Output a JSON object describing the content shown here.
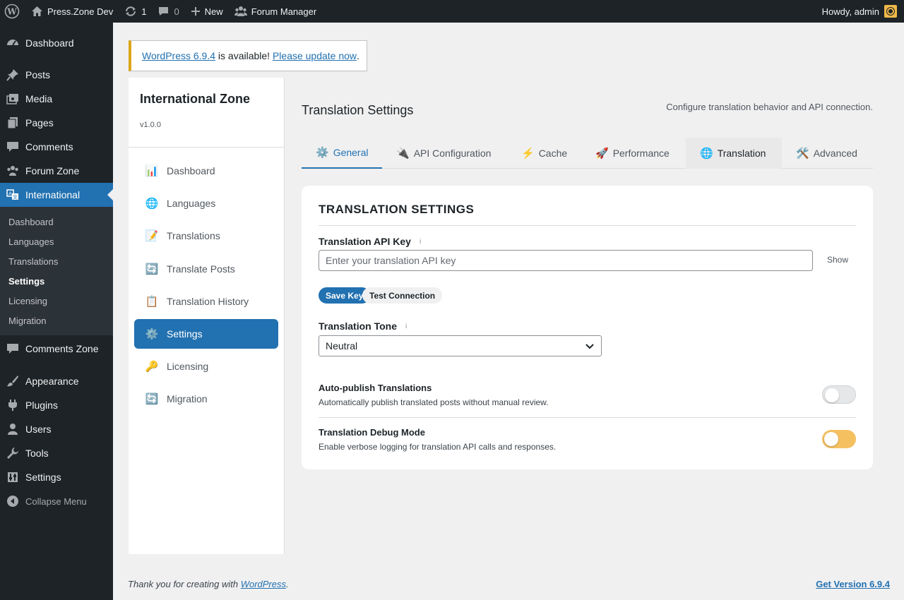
{
  "adminbar": {
    "site_name": "Press.Zone Dev",
    "updates_count": "1",
    "comments_count": "0",
    "new_label": "New",
    "forum_manager_label": "Forum Manager",
    "howdy": "Howdy, admin"
  },
  "sidebar": {
    "items": [
      {
        "label": "Dashboard",
        "icon": "dashboard-icon"
      },
      {
        "label": "Posts",
        "icon": "pin-icon"
      },
      {
        "label": "Media",
        "icon": "media-icon"
      },
      {
        "label": "Pages",
        "icon": "pages-icon"
      },
      {
        "label": "Comments",
        "icon": "comment-icon"
      },
      {
        "label": "Forum Zone",
        "icon": "groups-icon"
      },
      {
        "label": "International",
        "icon": "translation-icon"
      },
      {
        "label": "Comments Zone",
        "icon": "comment-icon"
      },
      {
        "label": "Appearance",
        "icon": "brush-icon"
      },
      {
        "label": "Plugins",
        "icon": "plug-icon"
      },
      {
        "label": "Users",
        "icon": "user-icon"
      },
      {
        "label": "Tools",
        "icon": "wrench-icon"
      },
      {
        "label": "Settings",
        "icon": "settings-icon"
      },
      {
        "label": "Collapse Menu",
        "icon": "collapse-icon"
      }
    ],
    "submenu": [
      "Dashboard",
      "Languages",
      "Translations",
      "Settings",
      "Licensing",
      "Migration"
    ]
  },
  "notice": {
    "link1": "WordPress 6.9.4",
    "middle": " is available! ",
    "link2": "Please update now",
    "end": "."
  },
  "plugin": {
    "name": "International Zone",
    "version": "v1.0.0",
    "nav": [
      {
        "label": "Dashboard",
        "icon": "📊"
      },
      {
        "label": "Languages",
        "icon": "🌐"
      },
      {
        "label": "Translations",
        "icon": "📝"
      },
      {
        "label": "Translate Posts",
        "icon": "🔄"
      },
      {
        "label": "Translation History",
        "icon": "📋"
      },
      {
        "label": "Settings",
        "icon": "⚙️"
      },
      {
        "label": "Licensing",
        "icon": "🔑"
      },
      {
        "label": "Migration",
        "icon": "🔄"
      }
    ]
  },
  "main": {
    "title": "Translation Settings",
    "description": "Configure translation behavior and API connection.",
    "tabs": [
      {
        "label": "General",
        "icon": "⚙️"
      },
      {
        "label": "API Configuration",
        "icon": "🔌"
      },
      {
        "label": "Cache",
        "icon": "⚡"
      },
      {
        "label": "Performance",
        "icon": "🚀"
      },
      {
        "label": "Translation",
        "icon": "🌐"
      },
      {
        "label": "Advanced",
        "icon": "🛠️"
      }
    ],
    "card": {
      "heading": "TRANSLATION SETTINGS",
      "api_key_label": "Translation API Key",
      "info_glyph": "i",
      "api_key_placeholder": "Enter your translation API key",
      "api_key_value": "",
      "show_label": "Show",
      "save_key_label": "Save Key",
      "test_connection_label": "Test Connection",
      "tone_label": "Translation Tone",
      "tone_value": "Neutral",
      "autopublish_label": "Auto-publish Translations",
      "autopublish_desc": "Automatically publish translated posts without manual review.",
      "autopublish_on": false,
      "debug_label": "Translation Debug Mode",
      "debug_desc": "Enable verbose logging for translation API calls and responses.",
      "debug_on": true
    }
  },
  "footer": {
    "thanks_prefix": "Thank you for creating with ",
    "thanks_link": "WordPress",
    "thanks_suffix": ".",
    "version_link": "Get Version 6.9.4"
  }
}
